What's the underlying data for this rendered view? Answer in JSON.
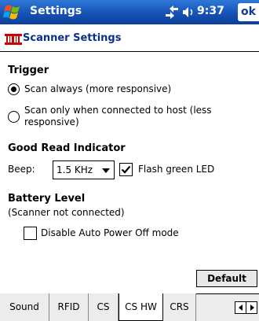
{
  "titlebar": {
    "title": "Settings",
    "time": "9:37",
    "ok_label": "ok"
  },
  "header": {
    "title": "Scanner Settings"
  },
  "trigger": {
    "heading": "Trigger",
    "option1": "Scan always (more responsive)",
    "option2_line1": "Scan only when connected to host (less",
    "option2_line2": "responsive)",
    "selected": "option1"
  },
  "good_read": {
    "heading": "Good Read Indicator",
    "beep_label": "Beep:",
    "beep_value": "1.5 KHz",
    "flash_label": "Flash green LED",
    "flash_checked": true
  },
  "battery": {
    "heading": "Battery Level",
    "status": "(Scanner not connected)",
    "disable_label": "Disable Auto Power Off mode",
    "disable_checked": false
  },
  "default_button": "Default",
  "tabs": [
    "Sound",
    "RFID",
    "CS",
    "CS HW",
    "CRS"
  ],
  "active_tab": "CS HW"
}
